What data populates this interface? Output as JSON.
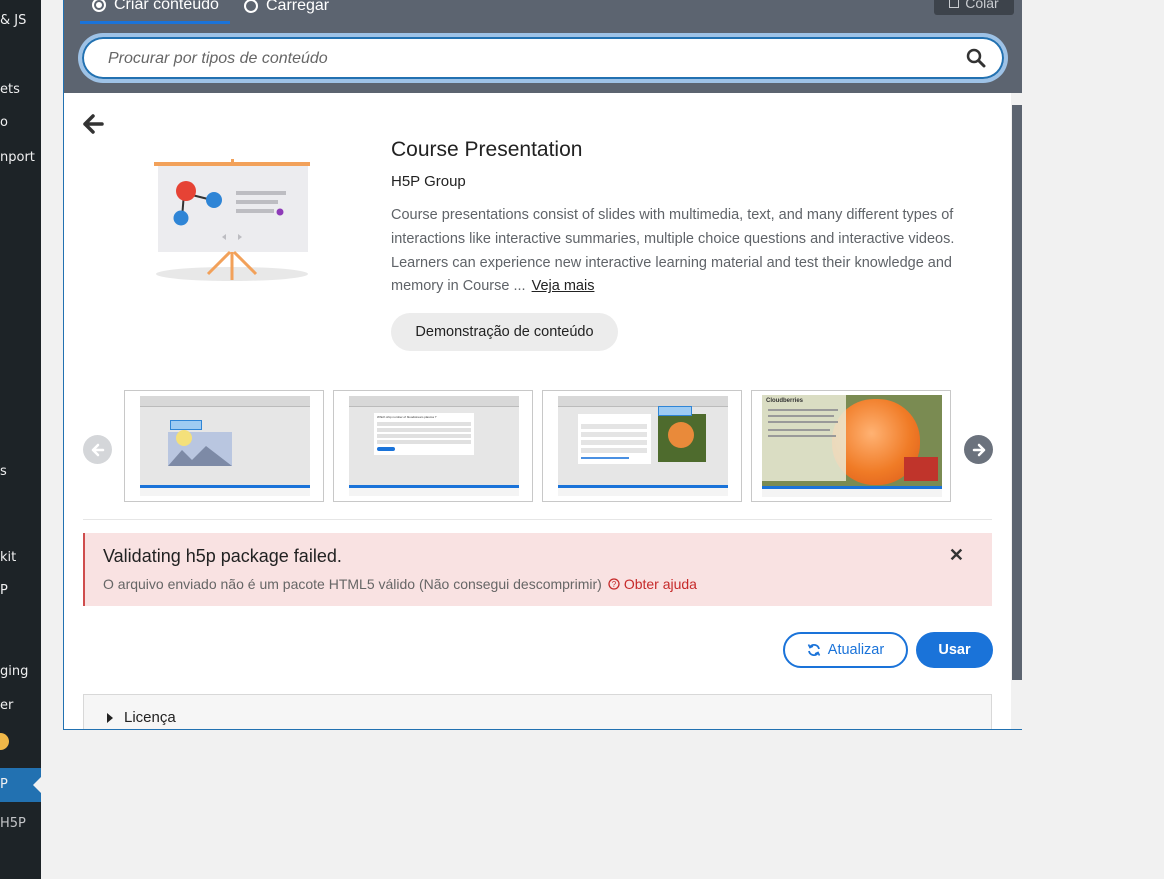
{
  "sidebar": {
    "items": [
      {
        "label": "& JS"
      },
      {
        "label": "ets"
      },
      {
        "label": "o"
      },
      {
        "label": "nport"
      },
      {
        "label": "s"
      },
      {
        "label": "kit"
      },
      {
        "label": "P"
      },
      {
        "label": "ging"
      },
      {
        "label": "er"
      },
      {
        "label": "P"
      },
      {
        "label": "H5P"
      }
    ]
  },
  "tabs": {
    "create": "Criar conteúdo",
    "upload": "Carregar",
    "paste": "Colar"
  },
  "search": {
    "placeholder": "Procurar por tipos de conteúdo"
  },
  "detail": {
    "title": "Course Presentation",
    "owner": "H5P Group",
    "description": "Course presentations consist of slides with multimedia, text, and many different types of interactions like interactive summaries, multiple choice questions and interactive videos. Learners can experience new interactive learning material and test their knowledge and memory in Course ...",
    "read_more": "Veja mais",
    "demo_button": "Demonstração de conteúdo"
  },
  "screenshots": {
    "shot2_question": "Which ship number of bloodstream plasma ?",
    "shot4_title": "Cloudberries"
  },
  "alert": {
    "title": "Validating h5p package failed.",
    "message": "O arquivo enviado não é um pacote HTML5 válido (Não consegui descomprimir)",
    "help": "Obter ajuda"
  },
  "actions": {
    "update": "Atualizar",
    "use": "Usar"
  },
  "license": {
    "label": "Licença"
  },
  "colors": {
    "primary": "#1a73d9",
    "topbar": "#5c6470",
    "alert_bg": "#f9e2e2",
    "help_red": "#c62a2a"
  }
}
